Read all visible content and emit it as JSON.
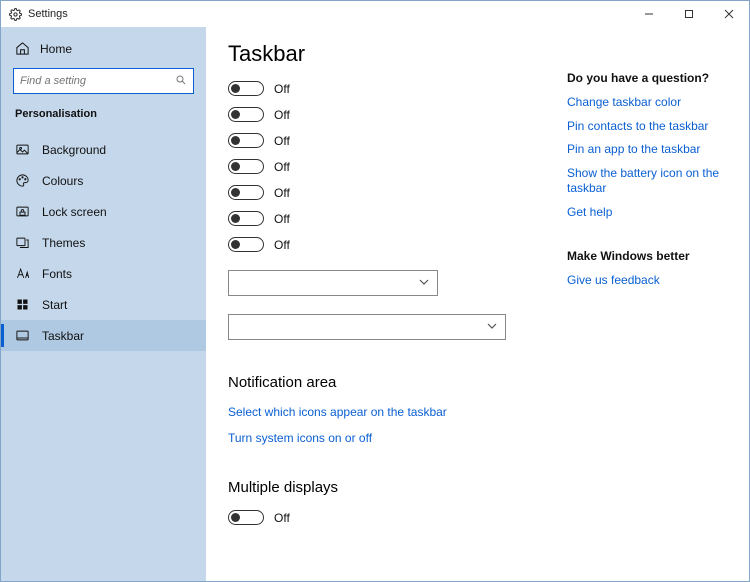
{
  "window": {
    "title": "Settings"
  },
  "sidebar": {
    "home": "Home",
    "search": {
      "placeholder": "Find a setting"
    },
    "section": "Personalisation",
    "items": [
      {
        "label": "Background"
      },
      {
        "label": "Colours"
      },
      {
        "label": "Lock screen"
      },
      {
        "label": "Themes"
      },
      {
        "label": "Fonts"
      },
      {
        "label": "Start"
      },
      {
        "label": "Taskbar"
      }
    ]
  },
  "page": {
    "title": "Taskbar",
    "toggles": [
      {
        "state": "Off"
      },
      {
        "state": "Off"
      },
      {
        "state": "Off"
      },
      {
        "state": "Off"
      },
      {
        "state": "Off"
      },
      {
        "state": "Off"
      },
      {
        "state": "Off"
      }
    ],
    "notification_header": "Notification area",
    "notification_links": [
      "Select which icons appear on the taskbar",
      "Turn system icons on or off"
    ],
    "multiple_header": "Multiple displays",
    "multiple_toggle": {
      "state": "Off"
    }
  },
  "right": {
    "question_header": "Do you have a question?",
    "question_links": [
      "Change taskbar color",
      "Pin contacts to the taskbar",
      "Pin an app to the taskbar",
      "Show the battery icon on the taskbar",
      "Get help"
    ],
    "feedback_header": "Make Windows better",
    "feedback_link": "Give us feedback"
  }
}
